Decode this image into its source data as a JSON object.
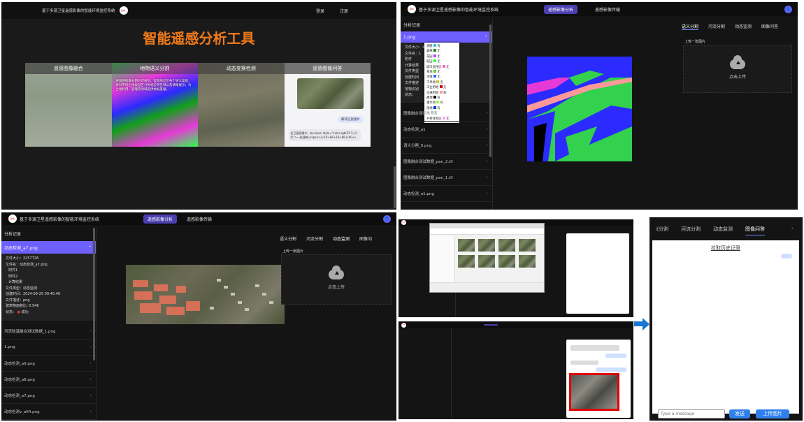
{
  "panel1": {
    "app_title": "基于多源卫星遥感影像的智能环境监控系统",
    "login": "登录",
    "register": "注册",
    "hero_title": "智能遥感分析工具",
    "cards": [
      {
        "title": "遥感图像融合"
      },
      {
        "title": "地物语义分割",
        "desc": "将遥感图像分割为可视化、直观地显示各个语义类别，并对不同土地类型区分到相应到区域以及清晰展示，为土地利用、管理等领域提供依据基础。"
      },
      {
        "title": "动态变换检测"
      },
      {
        "title": "遥感图像问答",
        "chat_button": "解读这张图片",
        "answer": "在卫星图像中，有<span style=\"color:rgb(25.5, 0, 0)\">一些建筑</span>(<10+86+18+86+(90+)"
      }
    ]
  },
  "panel2": {
    "app_title": "基于多源卫星遥感影像的智能环境监控系统",
    "nav_active": "遥感影像分析",
    "nav_other": "遥感影像传输",
    "sidebar_title": "分析记录",
    "selected": "1.png",
    "detail_lines": [
      "文件大小：431419",
      "文件名：1",
      "附件",
      "计算结果",
      "文件类型",
      "创建时间",
      "文件描述",
      "地物识别",
      "状态："
    ],
    "legend": [
      {
        "name": "道路",
        "color": "#33c7e6",
        "val": "有"
      },
      {
        "name": "森林",
        "color": "#1a8c1a",
        "val": "无"
      },
      {
        "name": "花园",
        "color": "#a64dff",
        "val": "无"
      },
      {
        "name": "稻田",
        "color": "#33ff33",
        "val": "无"
      },
      {
        "name": "城市居住区",
        "color": "#ff66cc",
        "val": "无"
      },
      {
        "name": "草地",
        "color": "#66cc33",
        "val": "无"
      },
      {
        "name": "水域",
        "color": "#3366ff",
        "val": "无"
      },
      {
        "name": "干旱地",
        "color": "#cccc33",
        "val": "无"
      },
      {
        "name": "工业用地",
        "color": "#cc0000",
        "val": "无"
      },
      {
        "name": "交通用地",
        "color": "#ff9999",
        "val": "有"
      },
      {
        "name": "裸地",
        "color": "#000000",
        "val": "有"
      },
      {
        "name": "灌木地",
        "color": "#99ff33",
        "val": "有"
      },
      {
        "name": "湿地",
        "color": "#0033cc",
        "val": "有"
      },
      {
        "name": "冰",
        "color": "#66ccff",
        "val": "无"
      },
      {
        "name": "乡村住宅区",
        "color": "#ff99ff",
        "val": "无"
      }
    ],
    "items": [
      "图像融合测试数据",
      "动态检测_a1",
      "语义分割_0.png",
      "图像融合测试数据_pan_2.tif",
      "图像融合测试数据_pan_1.tif",
      "动态检测_a1.png"
    ],
    "tabs": [
      "语义分割",
      "河流分割",
      "动态监测",
      "图像问答"
    ],
    "upload_label": "上传一张图片",
    "upload_hint": "点击上传"
  },
  "panel3": {
    "app_title": "基于多源卫星遥感影像的智能环境监控系统",
    "nav_active": "遥感影像分析",
    "nav_other": "遥感影像传输",
    "sidebar_title": "分析记录",
    "selected": "动态检测_a7.png",
    "detail_lines": [
      "文件大小：2257726",
      "文件名：动态检测_a7.png",
      "附件1",
      "附件2",
      "计算结果",
      "文件类型：动态监测",
      "创建时间：2024-09-25 09:45:46",
      "文件描述：png",
      "建筑物面积比: 0.946",
      "状态："
    ],
    "status": "成功",
    "items": [
      "河流陆温融合测试数据_1.png",
      "1.png",
      "动态检测_a9.png",
      "动态检测_a8.png",
      "动态检测_a7.png",
      "动态检测v_a64.png"
    ],
    "tabs": [
      "语义分割",
      "河流分割",
      "动态监测",
      "图像问"
    ],
    "upload_label": "上传一张图片",
    "upload_hint": "点击上传"
  },
  "panel6": {
    "tabs": [
      "《分割",
      "河流分割",
      "动态监测",
      "图像问答"
    ],
    "history_link": "拉取历史记录",
    "input_placeholder": "Type a message",
    "send": "发送",
    "upload": "上传图片"
  }
}
